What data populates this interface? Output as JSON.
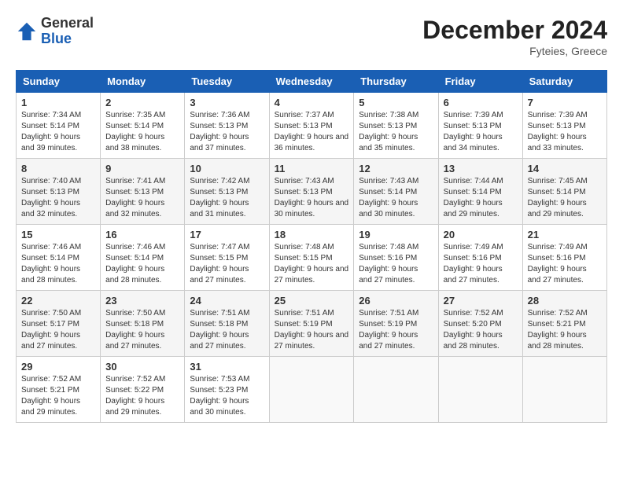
{
  "header": {
    "logo_line1": "General",
    "logo_line2": "Blue",
    "month_year": "December 2024",
    "location": "Fyteies, Greece"
  },
  "weekdays": [
    "Sunday",
    "Monday",
    "Tuesday",
    "Wednesday",
    "Thursday",
    "Friday",
    "Saturday"
  ],
  "weeks": [
    [
      {
        "day": "1",
        "sunrise": "7:34 AM",
        "sunset": "5:14 PM",
        "daylight": "9 hours and 39 minutes."
      },
      {
        "day": "2",
        "sunrise": "7:35 AM",
        "sunset": "5:14 PM",
        "daylight": "9 hours and 38 minutes."
      },
      {
        "day": "3",
        "sunrise": "7:36 AM",
        "sunset": "5:13 PM",
        "daylight": "9 hours and 37 minutes."
      },
      {
        "day": "4",
        "sunrise": "7:37 AM",
        "sunset": "5:13 PM",
        "daylight": "9 hours and 36 minutes."
      },
      {
        "day": "5",
        "sunrise": "7:38 AM",
        "sunset": "5:13 PM",
        "daylight": "9 hours and 35 minutes."
      },
      {
        "day": "6",
        "sunrise": "7:39 AM",
        "sunset": "5:13 PM",
        "daylight": "9 hours and 34 minutes."
      },
      {
        "day": "7",
        "sunrise": "7:39 AM",
        "sunset": "5:13 PM",
        "daylight": "9 hours and 33 minutes."
      }
    ],
    [
      {
        "day": "8",
        "sunrise": "7:40 AM",
        "sunset": "5:13 PM",
        "daylight": "9 hours and 32 minutes."
      },
      {
        "day": "9",
        "sunrise": "7:41 AM",
        "sunset": "5:13 PM",
        "daylight": "9 hours and 32 minutes."
      },
      {
        "day": "10",
        "sunrise": "7:42 AM",
        "sunset": "5:13 PM",
        "daylight": "9 hours and 31 minutes."
      },
      {
        "day": "11",
        "sunrise": "7:43 AM",
        "sunset": "5:13 PM",
        "daylight": "9 hours and 30 minutes."
      },
      {
        "day": "12",
        "sunrise": "7:43 AM",
        "sunset": "5:14 PM",
        "daylight": "9 hours and 30 minutes."
      },
      {
        "day": "13",
        "sunrise": "7:44 AM",
        "sunset": "5:14 PM",
        "daylight": "9 hours and 29 minutes."
      },
      {
        "day": "14",
        "sunrise": "7:45 AM",
        "sunset": "5:14 PM",
        "daylight": "9 hours and 29 minutes."
      }
    ],
    [
      {
        "day": "15",
        "sunrise": "7:46 AM",
        "sunset": "5:14 PM",
        "daylight": "9 hours and 28 minutes."
      },
      {
        "day": "16",
        "sunrise": "7:46 AM",
        "sunset": "5:14 PM",
        "daylight": "9 hours and 28 minutes."
      },
      {
        "day": "17",
        "sunrise": "7:47 AM",
        "sunset": "5:15 PM",
        "daylight": "9 hours and 27 minutes."
      },
      {
        "day": "18",
        "sunrise": "7:48 AM",
        "sunset": "5:15 PM",
        "daylight": "9 hours and 27 minutes."
      },
      {
        "day": "19",
        "sunrise": "7:48 AM",
        "sunset": "5:16 PM",
        "daylight": "9 hours and 27 minutes."
      },
      {
        "day": "20",
        "sunrise": "7:49 AM",
        "sunset": "5:16 PM",
        "daylight": "9 hours and 27 minutes."
      },
      {
        "day": "21",
        "sunrise": "7:49 AM",
        "sunset": "5:16 PM",
        "daylight": "9 hours and 27 minutes."
      }
    ],
    [
      {
        "day": "22",
        "sunrise": "7:50 AM",
        "sunset": "5:17 PM",
        "daylight": "9 hours and 27 minutes."
      },
      {
        "day": "23",
        "sunrise": "7:50 AM",
        "sunset": "5:18 PM",
        "daylight": "9 hours and 27 minutes."
      },
      {
        "day": "24",
        "sunrise": "7:51 AM",
        "sunset": "5:18 PM",
        "daylight": "9 hours and 27 minutes."
      },
      {
        "day": "25",
        "sunrise": "7:51 AM",
        "sunset": "5:19 PM",
        "daylight": "9 hours and 27 minutes."
      },
      {
        "day": "26",
        "sunrise": "7:51 AM",
        "sunset": "5:19 PM",
        "daylight": "9 hours and 27 minutes."
      },
      {
        "day": "27",
        "sunrise": "7:52 AM",
        "sunset": "5:20 PM",
        "daylight": "9 hours and 28 minutes."
      },
      {
        "day": "28",
        "sunrise": "7:52 AM",
        "sunset": "5:21 PM",
        "daylight": "9 hours and 28 minutes."
      }
    ],
    [
      {
        "day": "29",
        "sunrise": "7:52 AM",
        "sunset": "5:21 PM",
        "daylight": "9 hours and 29 minutes."
      },
      {
        "day": "30",
        "sunrise": "7:52 AM",
        "sunset": "5:22 PM",
        "daylight": "9 hours and 29 minutes."
      },
      {
        "day": "31",
        "sunrise": "7:53 AM",
        "sunset": "5:23 PM",
        "daylight": "9 hours and 30 minutes."
      },
      null,
      null,
      null,
      null
    ]
  ]
}
